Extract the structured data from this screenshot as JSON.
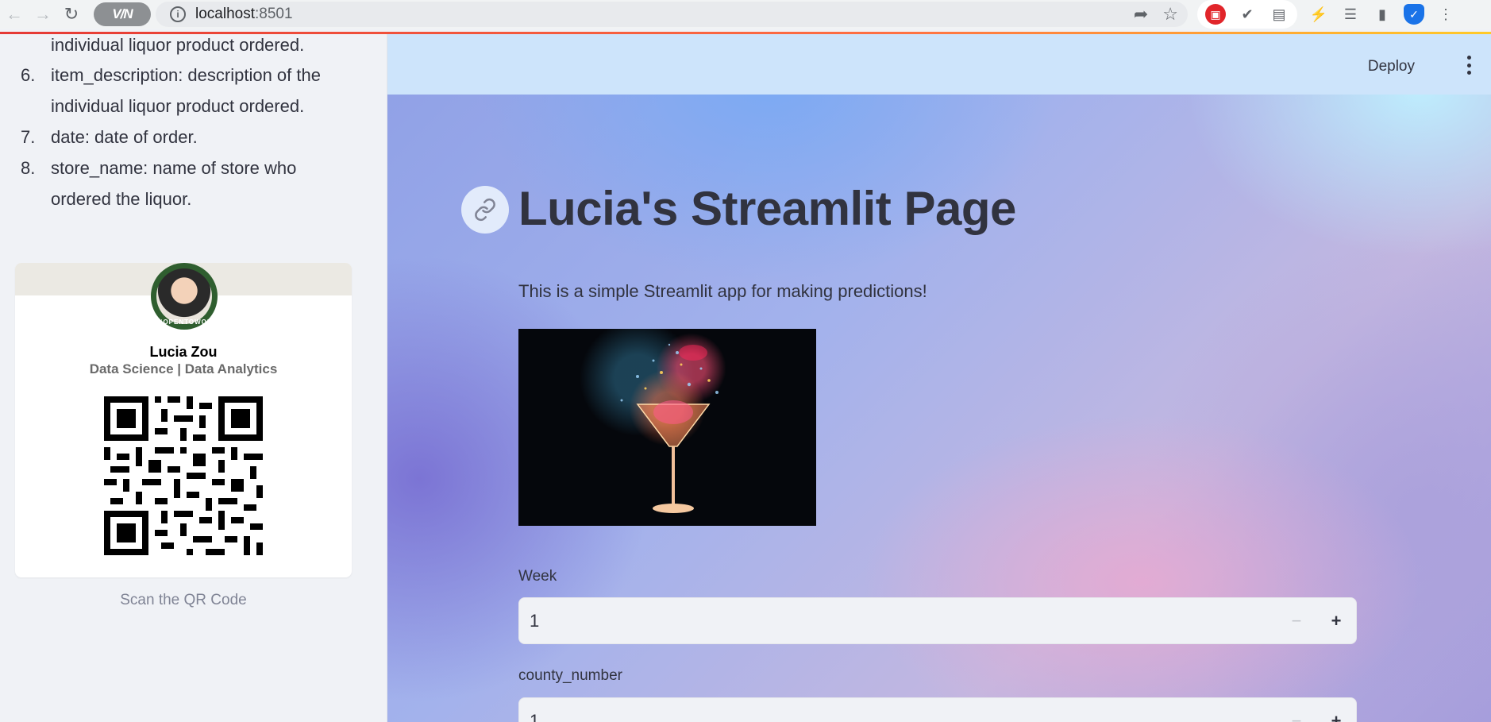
{
  "browser": {
    "url_host": "localhost",
    "url_port": ":8501",
    "vpn_label": "V/N"
  },
  "sidebar": {
    "fragment_line": "individual liquor product ordered.",
    "items": [
      {
        "num": "6.",
        "text": "item_description: description of the individual liquor product ordered."
      },
      {
        "num": "7.",
        "text": "date: date of order."
      },
      {
        "num": "8.",
        "text": "store_name: name of store who ordered the liquor."
      }
    ],
    "card": {
      "name": "Lucia Zou",
      "role": "Data Science | Data Analytics",
      "avatar_ring_text": "#OPENTOWORK"
    },
    "scan_label": "Scan the QR Code"
  },
  "main": {
    "header": {
      "deploy_label": "Deploy"
    },
    "title": "Lucia's Streamlit Page",
    "intro": "This is a simple Streamlit app for making predictions!",
    "fields": [
      {
        "label": "Week",
        "value": "1"
      },
      {
        "label": "county_number",
        "value": "1"
      }
    ]
  },
  "icons": [
    "back-icon",
    "forward-icon",
    "reload-icon",
    "info-icon",
    "share-icon",
    "star-icon",
    "extension-icon",
    "sidebar-icon",
    "menu-icon",
    "link-icon"
  ]
}
